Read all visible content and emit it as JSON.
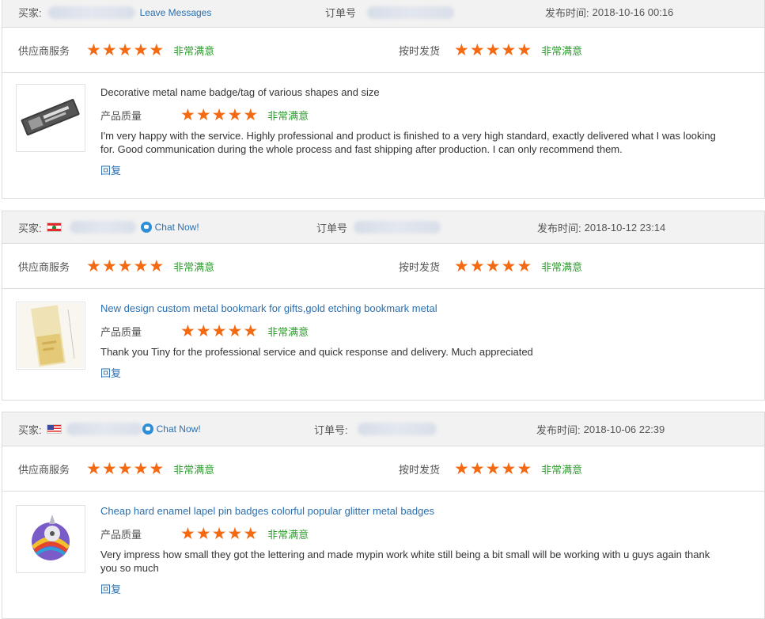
{
  "labels": {
    "buyer": "买家:",
    "order": "订单号",
    "order_colon": "订单号:",
    "published": "发布时间:",
    "supplier_service": "供应商服务",
    "on_time": "按时发货",
    "product_quality": "产品质量",
    "very_satisfied": "非常满意",
    "reply": "回复"
  },
  "reviews": [
    {
      "contact_link": "Leave Messages",
      "date": "2018-10-16 00:16",
      "supplier_rating": 5,
      "shipping_rating": 5,
      "quality_rating": 5,
      "product_title": "Decorative metal name badge/tag of various shapes and size",
      "comment": "I'm very happy with the service. Highly professional and product is finished to a very high standard, exactly delivered what I was looking for. Good communication during the whole process and fast shipping after production. I can only recommend them."
    },
    {
      "contact_link": "Chat Now!",
      "flag": "lebanon",
      "date": "2018-10-12 23:14",
      "supplier_rating": 5,
      "shipping_rating": 5,
      "quality_rating": 5,
      "product_title": "New design custom metal bookmark for gifts,gold etching bookmark metal",
      "comment": "Thank you Tiny for the professional service and quick response and delivery. Much appreciated"
    },
    {
      "contact_link": "Chat Now!",
      "flag": "usa",
      "date": "2018-10-06 22:39",
      "supplier_rating": 5,
      "shipping_rating": 5,
      "quality_rating": 5,
      "product_title": "Cheap hard enamel lapel pin badges colorful popular glitter metal badges",
      "comment": "Very impress how small they got the lettering and made mypin work white still being a bit small will be working with u guys again thank you so much"
    }
  ],
  "colors": {
    "star": "#f46a13",
    "satisfied": "#2f9e2f",
    "link": "#2a6fb0",
    "header_bg": "#f2f2f2"
  }
}
